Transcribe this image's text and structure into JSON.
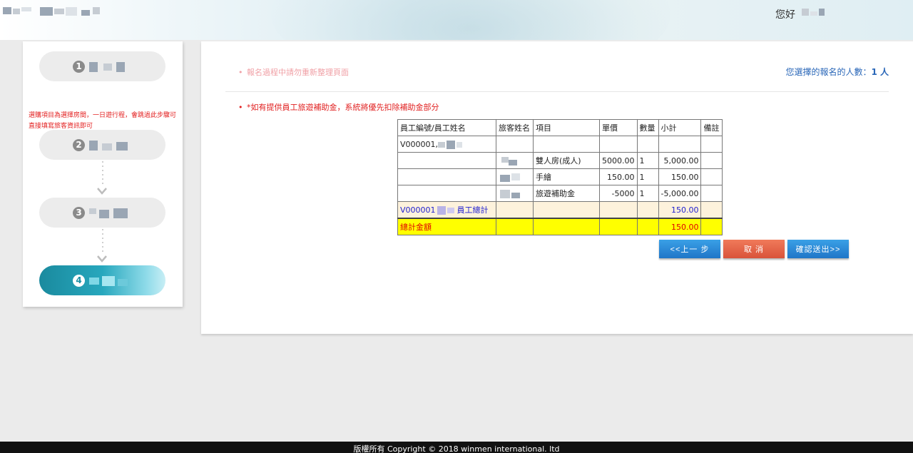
{
  "header": {
    "greeting": "您好"
  },
  "steps": {
    "items": [
      {
        "number": "1"
      },
      {
        "number": "2"
      },
      {
        "number": "3"
      },
      {
        "number": "4",
        "active": true
      }
    ],
    "note_line1": "選購項目為選擇房間，一日遊行程，會跳過此步驟可",
    "note_line2": "直接填寫旅客資訊即可"
  },
  "main": {
    "warning": "報名過程中請勿重新整理頁面",
    "selected_count_label": "您選擇的報名的人數：",
    "selected_count_value": "1 人",
    "notice": "*如有提供員工旅遊補助金，系統將優先扣除補助金部分"
  },
  "table": {
    "headers": [
      "員工編號/員工姓名",
      "旅客姓名",
      "項目",
      "單價",
      "數量",
      "小計",
      "備註"
    ],
    "employee_row": {
      "employee": "V000001,"
    },
    "rows": [
      {
        "item": "雙人房(成人)",
        "price": "5000.00",
        "qty": "1",
        "subtotal": "5,000.00"
      },
      {
        "item": "手繪",
        "price": "150.00",
        "qty": "1",
        "subtotal": "150.00"
      },
      {
        "item": "旅遊補助金",
        "price": "-5000",
        "qty": "1",
        "subtotal": "-5,000.00"
      }
    ],
    "employee_total": {
      "prefix": "V000001",
      "suffix": "員工總計",
      "subtotal": "150.00"
    },
    "grand_total": {
      "label": "總計金額",
      "subtotal": "150.00"
    }
  },
  "buttons": {
    "prev": "<<上一 步",
    "cancel": "取 消",
    "confirm": "確認送出>>"
  },
  "footer": {
    "copyright": "版權所有 Copyright © 2018 winmen international. ltd"
  },
  "colors": {
    "accent": "#1f76c8",
    "cancel": "#d9533a",
    "subtotal_row_bg": "#fdf2dc",
    "grand_total_bg": "#ffff00",
    "notice_red": "#e12020"
  }
}
